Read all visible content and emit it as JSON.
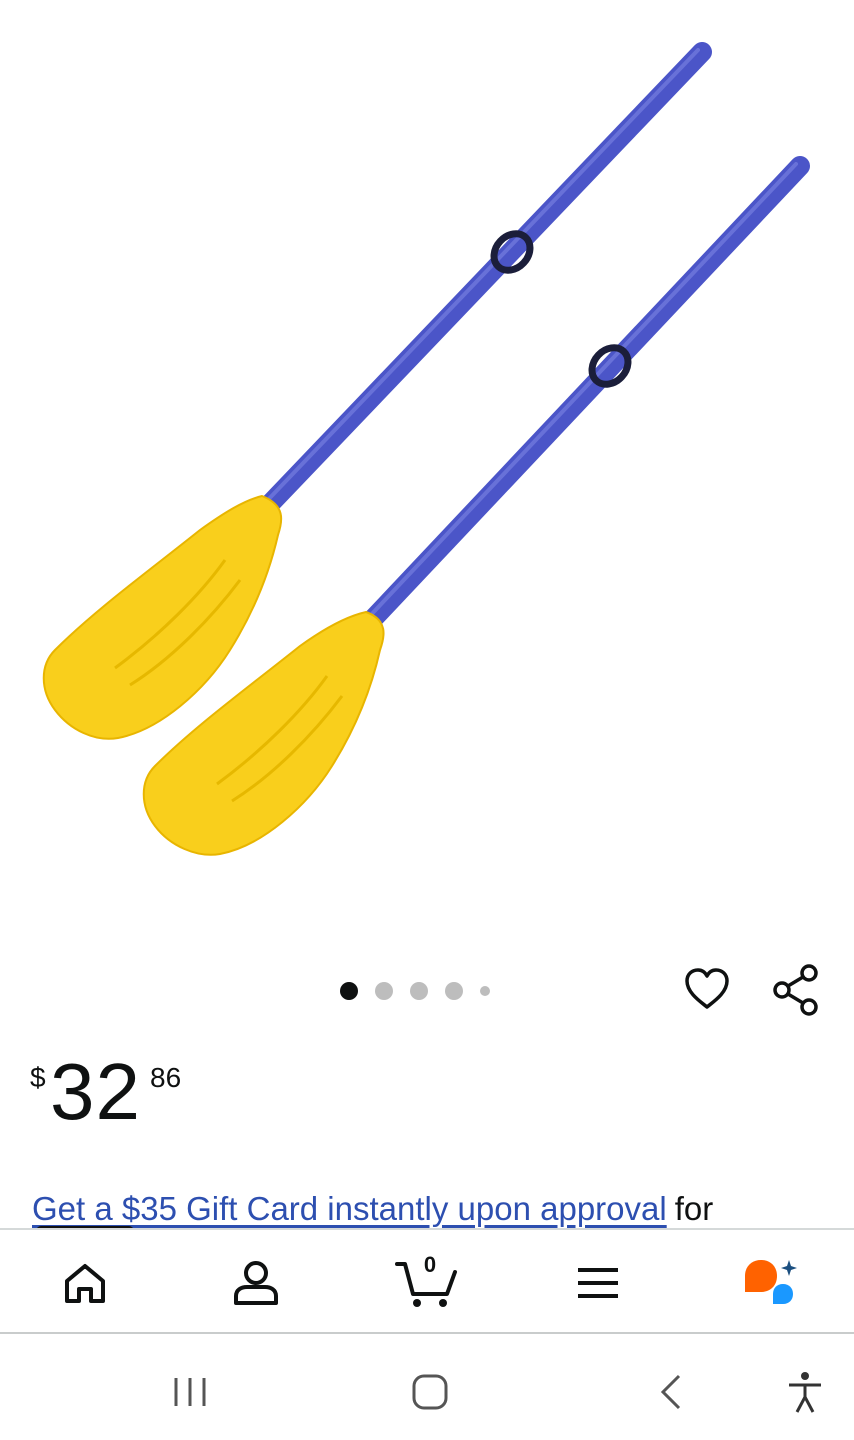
{
  "product": {
    "image_alt": "Two inflatable boat oars with blue shafts and yellow paddles",
    "image_dots_total": 5,
    "image_dot_active": 1
  },
  "price": {
    "currency": "$",
    "whole": "32",
    "fraction": "86"
  },
  "promo": {
    "link_text": "Get a $35 Gift Card instantly upon approval",
    "rest_text": "for"
  },
  "nav": {
    "cart_count": "0"
  },
  "icons": {
    "wishlist": "heart-icon",
    "share": "share-icon",
    "home": "home-icon",
    "account": "account-icon",
    "cart": "cart-icon",
    "menu": "menu-icon",
    "assistant": "assistant-icon",
    "recent_apps": "recent-apps-icon",
    "system_home": "system-home-icon",
    "back": "back-icon",
    "accessibility": "accessibility-icon"
  },
  "colors": {
    "oar_shaft": "#4b55c8",
    "oar_blade": "#f9cf1c",
    "promo_link": "#2d4fb0",
    "assistant_orange": "#ff6200",
    "assistant_blue": "#1a98ff"
  }
}
